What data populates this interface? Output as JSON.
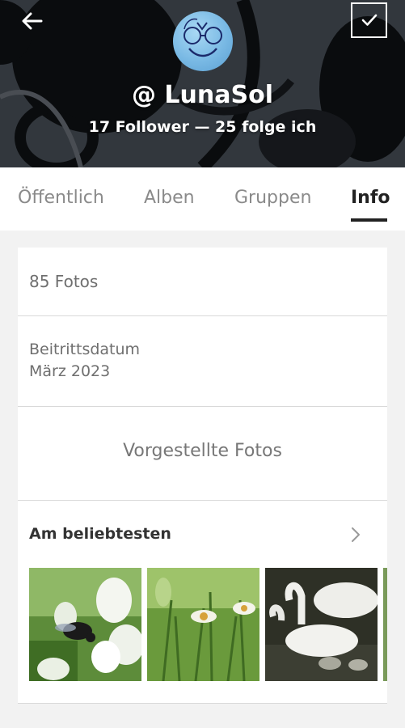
{
  "header": {
    "username": "@ LunaSol",
    "follow_line": "17 Follower — 25 folge ich",
    "back_icon": "arrow-left-icon",
    "confirm_icon": "check-icon"
  },
  "tabs": [
    {
      "label": "Öffentlich",
      "active": false
    },
    {
      "label": "Alben",
      "active": false
    },
    {
      "label": "Gruppen",
      "active": false
    },
    {
      "label": "Info",
      "active": true
    }
  ],
  "info": {
    "photos_count": "85 Fotos",
    "joined_label": "Beitrittsdatum",
    "joined_value": "März 2023",
    "featured_label": "Vorgestellte Fotos",
    "popular_title": "Am beliebtesten"
  },
  "popular_photos": [
    {
      "subject": "bumblebee on white flowers"
    },
    {
      "subject": "daisies in green grass"
    },
    {
      "subject": "swans with cygnets on water"
    }
  ],
  "colors": {
    "active_tab": "#222222",
    "inactive_tab": "#8a8a8a",
    "page_background": "#f2f2f2"
  }
}
